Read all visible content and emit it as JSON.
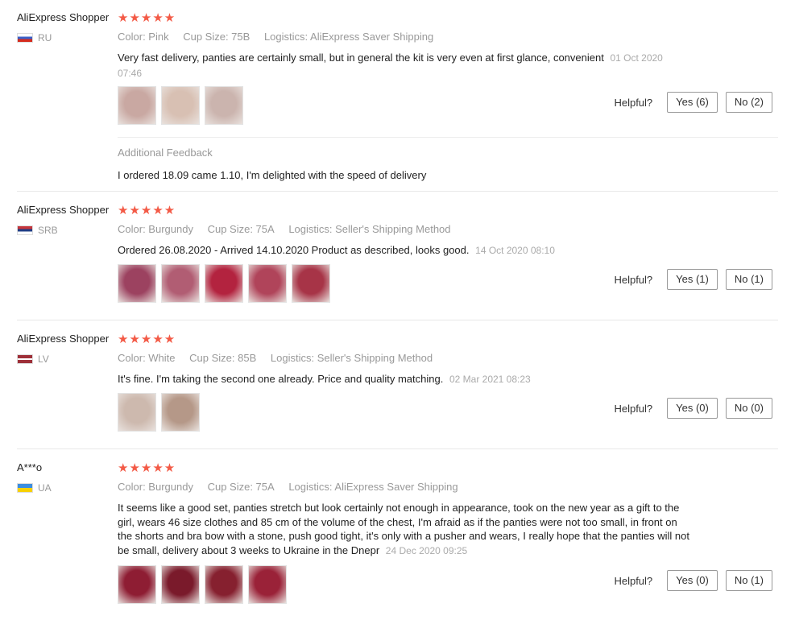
{
  "reviews": [
    {
      "author": "AliExpress Shopper",
      "country": "RU",
      "stars": "★★★★★",
      "rating": 5,
      "attrs": [
        "Color: Pink",
        "Cup Size: 75B",
        "Logistics: AliExpress Saver Shipping"
      ],
      "text": "Very fast delivery, panties are certainly small, but in general the kit is very even at first glance, convenient",
      "date": "01 Oct 2020 07:46",
      "photo_colors": [
        "#c9a8a2",
        "#d8c0b3",
        "#cbb4ae"
      ],
      "helpful_label": "Helpful?",
      "yes": "Yes (6)",
      "no": "No (2)",
      "additional_title": "Additional Feedback",
      "additional_text": "I ordered 18.09 came 1.10, I'm delighted with the speed of delivery"
    },
    {
      "author": "AliExpress Shopper",
      "country": "SRB",
      "stars": "★★★★★",
      "rating": 5,
      "attrs": [
        "Color: Burgundy",
        "Cup Size: 75A",
        "Logistics: Seller's Shipping Method"
      ],
      "text": "Ordered 26.08.2020 - Arrived 14.10.2020 Product as described, looks good.",
      "date": "14 Oct 2020 08:10",
      "photo_colors": [
        "#9c4260",
        "#b15d73",
        "#b3233f",
        "#b0445a",
        "#a73447"
      ],
      "helpful_label": "Helpful?",
      "yes": "Yes (1)",
      "no": "No (1)"
    },
    {
      "author": "AliExpress Shopper",
      "country": "LV",
      "stars": "★★★★★",
      "rating": 5,
      "attrs": [
        "Color: White",
        "Cup Size: 85B",
        "Logistics: Seller's Shipping Method"
      ],
      "text": "It's fine. I'm taking the second one already. Price and quality matching.",
      "date": "02 Mar 2021 08:23",
      "photo_colors": [
        "#cdb9ae",
        "#b59888"
      ],
      "helpful_label": "Helpful?",
      "yes": "Yes (0)",
      "no": "No (0)"
    },
    {
      "author": "A***o",
      "country": "UA",
      "stars": "★★★★★",
      "rating": 5,
      "attrs": [
        "Color: Burgundy",
        "Cup Size: 75A",
        "Logistics: AliExpress Saver Shipping"
      ],
      "text": "It seems like a good set, panties stretch but look certainly not enough in appearance, took on the new year as a gift to the girl, wears 46 size clothes and 85 cm of the volume of the chest, I'm afraid as if the panties were not too small, in front on the shorts and bra bow with a stone, push good tight, it's only with a pusher and wears, I really hope that the panties will not be small, delivery about 3 weeks to Ukraine in the Dnepr",
      "date": "24 Dec 2020 09:25",
      "photo_colors": [
        "#8e1d33",
        "#7a1a2b",
        "#86202f",
        "#9a2238"
      ],
      "helpful_label": "Helpful?",
      "yes": "Yes (0)",
      "no": "No (1)"
    }
  ]
}
